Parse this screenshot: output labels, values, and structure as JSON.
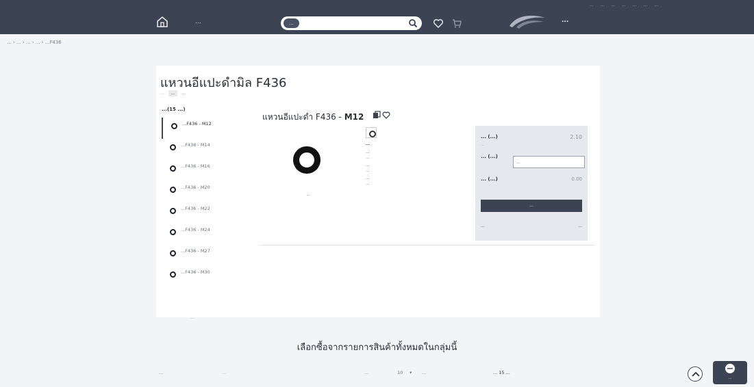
{
  "header": {
    "utility_links": [
      "...",
      "...",
      "...",
      "...",
      "...",
      "...",
      "..."
    ],
    "category_label": "...",
    "search_scope": "...",
    "search_placeholder": "",
    "brand_name": "..."
  },
  "breadcrumb": "... › ... › ... › ... › ...F436",
  "product": {
    "title": "แหวนอีแปะดำมิล F436",
    "meta_items": [
      "...",
      "...",
      "..."
    ]
  },
  "group": {
    "heading": "...(15 ...)",
    "items": [
      {
        "label": "...F436 - M12"
      },
      {
        "label": "...F436 - M14"
      },
      {
        "label": "...F436 - M16"
      },
      {
        "label": "...F436 - M20"
      },
      {
        "label": "...F436 - M22"
      },
      {
        "label": "...F436 - M24"
      },
      {
        "label": "...F436 - M27"
      },
      {
        "label": "...F436 - M30"
      }
    ],
    "more": "..."
  },
  "variant": {
    "title_prefix": "แหวนอีแปะดำ F436 -",
    "size": "M12",
    "image_caption": "..."
  },
  "spec": {
    "heading": "...",
    "lines": [
      {
        "k": "...",
        "v": "..."
      },
      {
        "k": "...",
        "v": "..."
      },
      {
        "k": "...",
        "v": "..."
      }
    ]
  },
  "pricebox": {
    "price_label": "... (...)",
    "price_value": "2.10",
    "price_note": "...",
    "qty_label": "...\n(...)",
    "qty_placeholder": "...",
    "sum_label": "... (...)",
    "sum_value": "0.00",
    "add_button": "...",
    "link_left": "...",
    "link_right": "..."
  },
  "bulk": {
    "title": "เลือกซื้อจากรายการสินค้าทั้งหมดในกลุ่มนี้"
  },
  "bottombar": {
    "search_label": "...",
    "search_placeholder": "...",
    "show_label": "...",
    "per_page": "10",
    "per_page_suffix": "...",
    "total_text": "... 15 ..."
  },
  "chat": {
    "label": "..."
  }
}
